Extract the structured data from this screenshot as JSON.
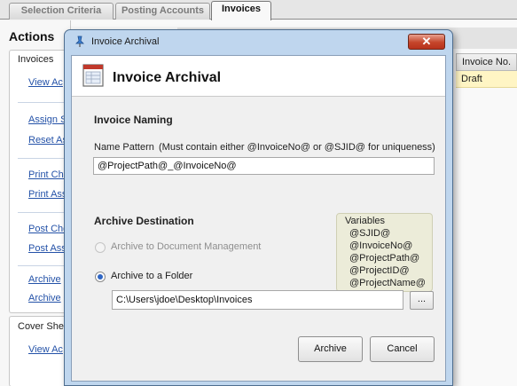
{
  "app": {
    "tabs": [
      {
        "label": "Selection Criteria"
      },
      {
        "label": "Posting Accounts"
      },
      {
        "label": "Invoices"
      }
    ],
    "actions": {
      "title": "Actions",
      "invoices_group": "Invoices",
      "links": [
        "View Ac",
        "Assign S",
        "Reset As",
        "Print Che",
        "Print Ass",
        "Post Che",
        "Post Ass",
        "Archive",
        "Archive"
      ],
      "cover_group": "Cover She",
      "cover_link": "View Ac"
    },
    "grid": {
      "column_header": "Invoice No.",
      "cell_value": "Draft"
    }
  },
  "dialog": {
    "window_title": "Invoice Archival",
    "close_glyph": "✕",
    "header_title": "Invoice Archival",
    "naming": {
      "section_title": "Invoice Naming",
      "pattern_label": "Name Pattern",
      "pattern_hint": "(Must contain either @InvoiceNo@ or @SJID@ for uniqueness)",
      "pattern_value": "@ProjectPath@_@InvoiceNo@"
    },
    "variables": {
      "title": "Variables",
      "items": [
        "@SJID@",
        "@InvoiceNo@",
        "@ProjectPath@",
        "@ProjectID@",
        "@ProjectName@"
      ]
    },
    "destination": {
      "section_title": "Archive Destination",
      "option_docmgmt": "Archive to Document Management",
      "option_folder": "Archive to a Folder",
      "selected": "folder",
      "folder_path": "C:\\Users\\jdoe\\Desktop\\Invoices",
      "browse_label": "..."
    },
    "buttons": {
      "archive": "Archive",
      "cancel": "Cancel"
    }
  },
  "colors": {
    "dialog_frame": "#bfd6ee",
    "close_button": "#c5452a",
    "link": "#2452a8",
    "grid_row_highlight": "#fff5c4",
    "variables_box": "#ececd9"
  },
  "icons": {
    "dialog_title_icon": "archive-pin-icon",
    "header_icon": "invoice-document-icon"
  }
}
